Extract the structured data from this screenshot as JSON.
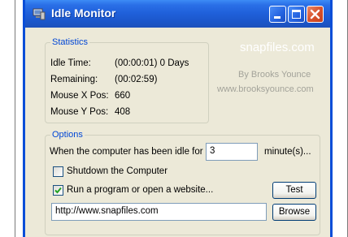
{
  "window": {
    "title": "Idle Monitor",
    "icon": "monitor-app-icon",
    "controls": [
      "minimize-icon",
      "maximize-icon",
      "close-icon"
    ]
  },
  "watermark": "snapfiles.com",
  "statistics": {
    "legend": "Statistics",
    "idle_time_label": "Idle Time:",
    "idle_time_value": "(00:00:01) 0 Days",
    "remaining_label": "Remaining:",
    "remaining_value": "(00:02:59)",
    "mouse_x_label": "Mouse X Pos:",
    "mouse_x_value": "660",
    "mouse_y_label": "Mouse Y Pos:",
    "mouse_y_value": "408"
  },
  "credits": {
    "author": "By Brooks Younce",
    "website": "www.brooksyounce.com"
  },
  "options": {
    "legend": "Options",
    "idle_prefix": "When the computer has been idle for",
    "idle_minutes": "3",
    "idle_suffix": "minute(s)...",
    "shutdown_label": "Shutdown the Computer",
    "shutdown_checked": false,
    "run_label": "Run a program or open a website...",
    "run_checked": true,
    "test_label": "Test",
    "url_value": "http://www.snapfiles.com",
    "browse_label": "Browse"
  },
  "colors": {
    "titlebar": "#1f5fd9",
    "window_bg": "#ece9d8",
    "group_legend": "#0046d5",
    "checkmark": "#21a121"
  }
}
